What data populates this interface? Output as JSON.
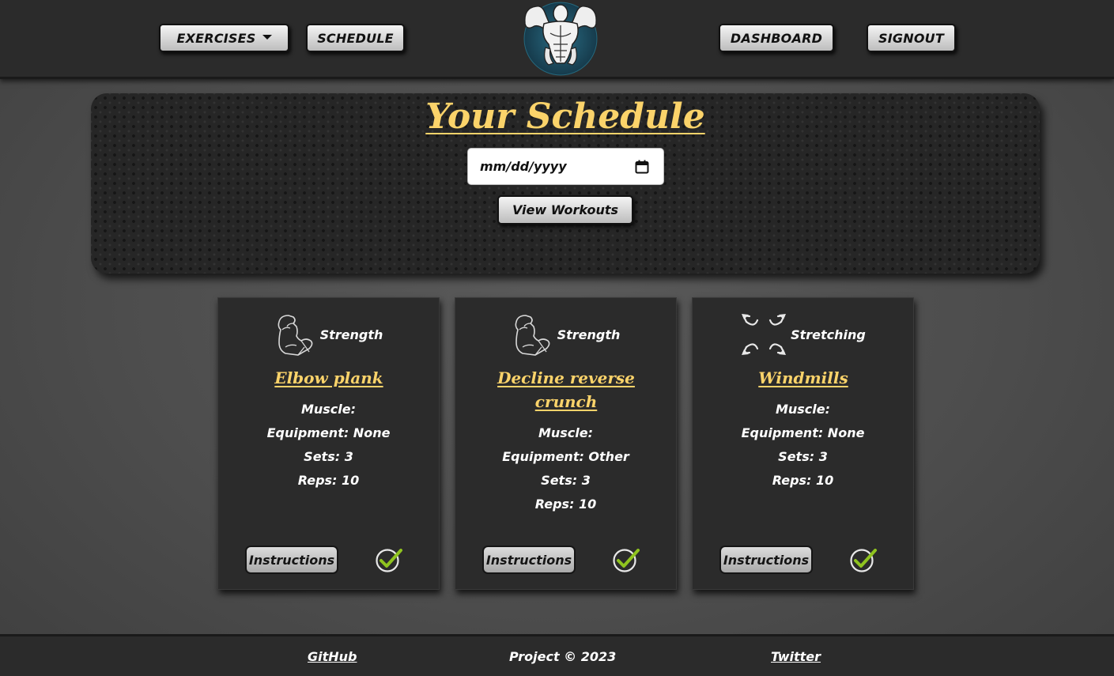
{
  "nav": {
    "exercises_label": "EXERCISES",
    "schedule_label": "SCHEDULE",
    "dashboard_label": "DASHBOARD",
    "signout_label": "SIGNOUT"
  },
  "schedule": {
    "title": "Your Schedule",
    "date_placeholder": "mm/dd/yyyy",
    "view_button": "View Workouts"
  },
  "cards": [
    {
      "category": "Strength",
      "category_icon": "flexed-arm-icon",
      "name": "Elbow plank",
      "muscle": "Muscle:",
      "equipment": "Equipment: None",
      "sets": "Sets: 3",
      "reps": "Reps: 10",
      "instructions_label": "Instructions"
    },
    {
      "category": "Strength",
      "category_icon": "flexed-arm-icon",
      "name": "Decline reverse crunch",
      "muscle": "Muscle:",
      "equipment": "Equipment: Other",
      "sets": "Sets: 3",
      "reps": "Reps: 10",
      "instructions_label": "Instructions"
    },
    {
      "category": "Stretching",
      "category_icon": "expand-arrows-icon",
      "name": "Windmills",
      "muscle": "Muscle:",
      "equipment": "Equipment: None",
      "sets": "Sets: 3",
      "reps": "Reps: 10",
      "instructions_label": "Instructions"
    }
  ],
  "footer": {
    "github": "GitHub",
    "copyright": "Project © 2023",
    "twitter": "Twitter"
  },
  "colors": {
    "accent": "#fbd36a",
    "check_green": "#8fc31f"
  }
}
